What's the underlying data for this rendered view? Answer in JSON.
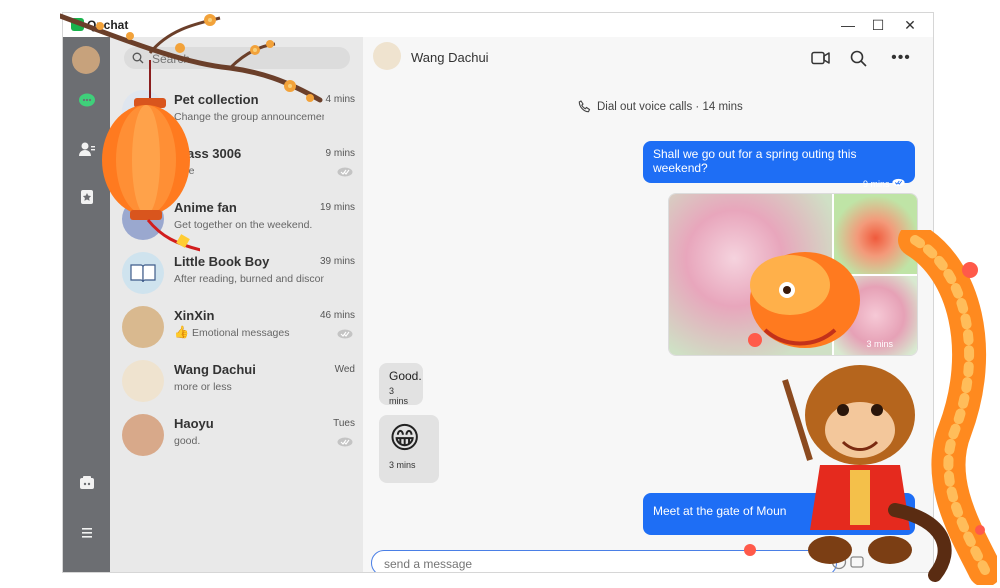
{
  "app": {
    "title": "Qpchat"
  },
  "window_controls": {
    "minimize": "—",
    "maximize": "☐",
    "close": "✕"
  },
  "search": {
    "placeholder": "Search"
  },
  "conversations": [
    {
      "name": "Pet collection",
      "preview": "Change the group announcement to“ ”",
      "time": "4 mins"
    },
    {
      "name": "Class 3006",
      "preview": "Fine",
      "time": "9 mins"
    },
    {
      "name": "Anime fan",
      "preview": "Get together on the weekend.",
      "time": "19 mins"
    },
    {
      "name": "Little Book Boy",
      "preview": "After reading, burned and discontinued.",
      "time": "39 mins"
    },
    {
      "name": "XinXin",
      "preview": "Emotional messages",
      "time": "46 mins"
    },
    {
      "name": "Wang Dachui",
      "preview": "more or less",
      "time": "Wed"
    },
    {
      "name": "Haoyu",
      "preview": "good.",
      "time": "Tues"
    }
  ],
  "chat": {
    "peer_name": "Wang Dachui",
    "call_note": "Dial out voice calls · 14 mins",
    "messages": [
      {
        "dir": "out",
        "text": "Shall we go out for a spring outing this weekend?",
        "time": "9 mins"
      },
      {
        "dir": "out",
        "type": "photos",
        "time": "3 mins"
      },
      {
        "dir": "in",
        "text": "Good.",
        "time": "3 mins"
      },
      {
        "dir": "in",
        "type": "emoji",
        "text": "😁",
        "time": "3 mins"
      },
      {
        "dir": "out",
        "text": "Meet at the gate of Moun",
        "time": ""
      }
    ],
    "composer_placeholder": "send a message"
  },
  "colors": {
    "accent": "#1e6ef5",
    "rail": "#6c6e72",
    "list_bg": "#e9e9e9",
    "chat_bg": "#f7f7f7"
  }
}
